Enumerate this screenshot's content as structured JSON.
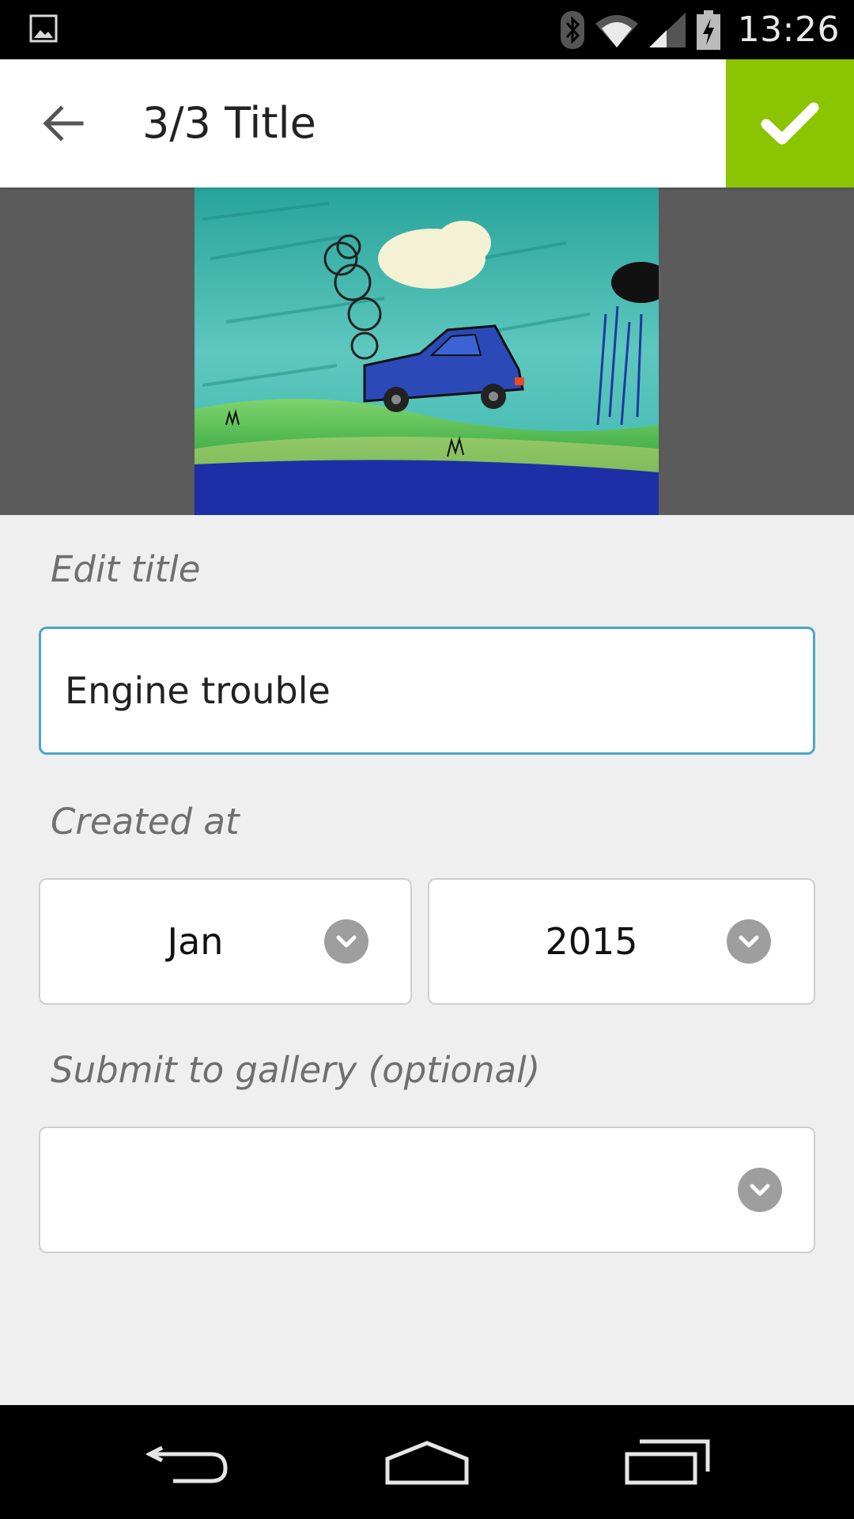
{
  "status_bar": {
    "time": "13:26",
    "icons": [
      "gallery-notification-icon",
      "bluetooth-icon",
      "wifi-icon",
      "signal-icon",
      "battery-charging-icon"
    ]
  },
  "app_bar": {
    "title": "3/3 Title",
    "back_icon": "arrow-left-icon",
    "confirm_icon": "checkmark-icon",
    "confirm_color": "#8bc400"
  },
  "form": {
    "title_section": {
      "label": "Edit title",
      "value": "Engine trouble"
    },
    "created_section": {
      "label": "Created at",
      "month": "Jan",
      "year": "2015"
    },
    "gallery_section": {
      "label": "Submit to gallery (optional)",
      "value": ""
    }
  },
  "nav_bar": {
    "icons": [
      "back-nav-icon",
      "home-nav-icon",
      "recents-nav-icon"
    ]
  }
}
